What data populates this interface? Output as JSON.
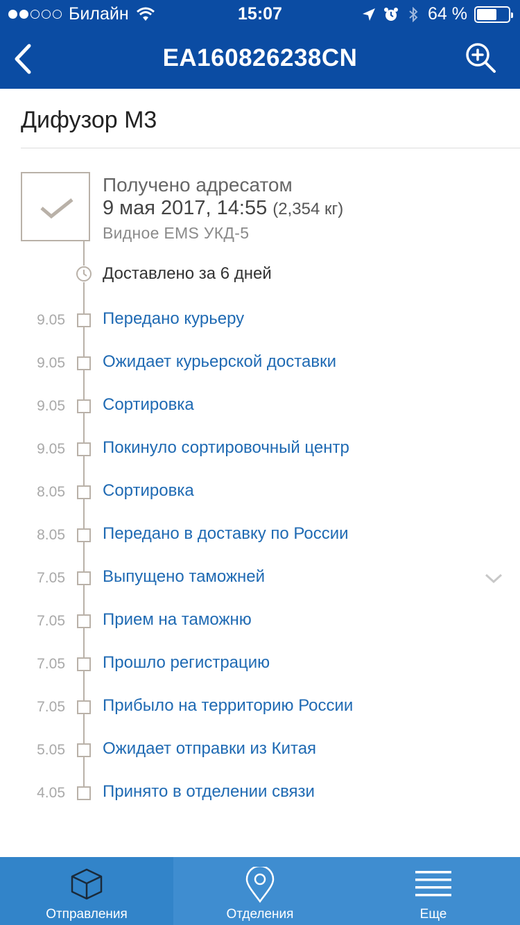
{
  "status_bar": {
    "carrier": "Билайн",
    "time": "15:07",
    "battery_percent": "64 %",
    "battery_level": 0.64,
    "signal_bars_filled": 2,
    "signal_bars_total": 5
  },
  "nav": {
    "title": "EA160826238CN",
    "back_icon": "chevron-left-icon",
    "zoom_icon": "zoom-in-icon"
  },
  "item": {
    "title": "Дифузор М3"
  },
  "current_status": {
    "title": "Получено адресатом",
    "date": "9 мая 2017, 14:55",
    "weight": "(2,354 кг)",
    "place": "Видное EMS УКД-5",
    "icon": "checkmark-icon"
  },
  "delivery_time": {
    "text": "Доставлено за 6 дней",
    "icon": "clock-icon"
  },
  "events": [
    {
      "date": "9.05",
      "label": "Передано курьеру"
    },
    {
      "date": "9.05",
      "label": "Ожидает курьерской доставки"
    },
    {
      "date": "9.05",
      "label": "Сортировка"
    },
    {
      "date": "9.05",
      "label": "Покинуло сортировочный центр"
    },
    {
      "date": "8.05",
      "label": "Сортировка"
    },
    {
      "date": "8.05",
      "label": "Передано в доставку по России"
    },
    {
      "date": "7.05",
      "label": "Выпущено таможней"
    },
    {
      "date": "7.05",
      "label": "Прием на таможню"
    },
    {
      "date": "7.05",
      "label": "Прошло регистрацию"
    },
    {
      "date": "7.05",
      "label": "Прибыло на территорию России"
    },
    {
      "date": "5.05",
      "label": "Ожидает отправки из Китая"
    },
    {
      "date": "4.05",
      "label": "Принято в отделении связи"
    }
  ],
  "tabs": [
    {
      "label": "Отправления",
      "icon": "box-icon",
      "active": true
    },
    {
      "label": "Отделения",
      "icon": "map-pin-icon",
      "active": false
    },
    {
      "label": "Еще",
      "icon": "menu-icon",
      "active": false
    }
  ],
  "colors": {
    "header": "#0b4ca3",
    "tabbar": "#3f8dd0",
    "link": "#1f6ab3",
    "timeline": "#b9b1a8"
  }
}
